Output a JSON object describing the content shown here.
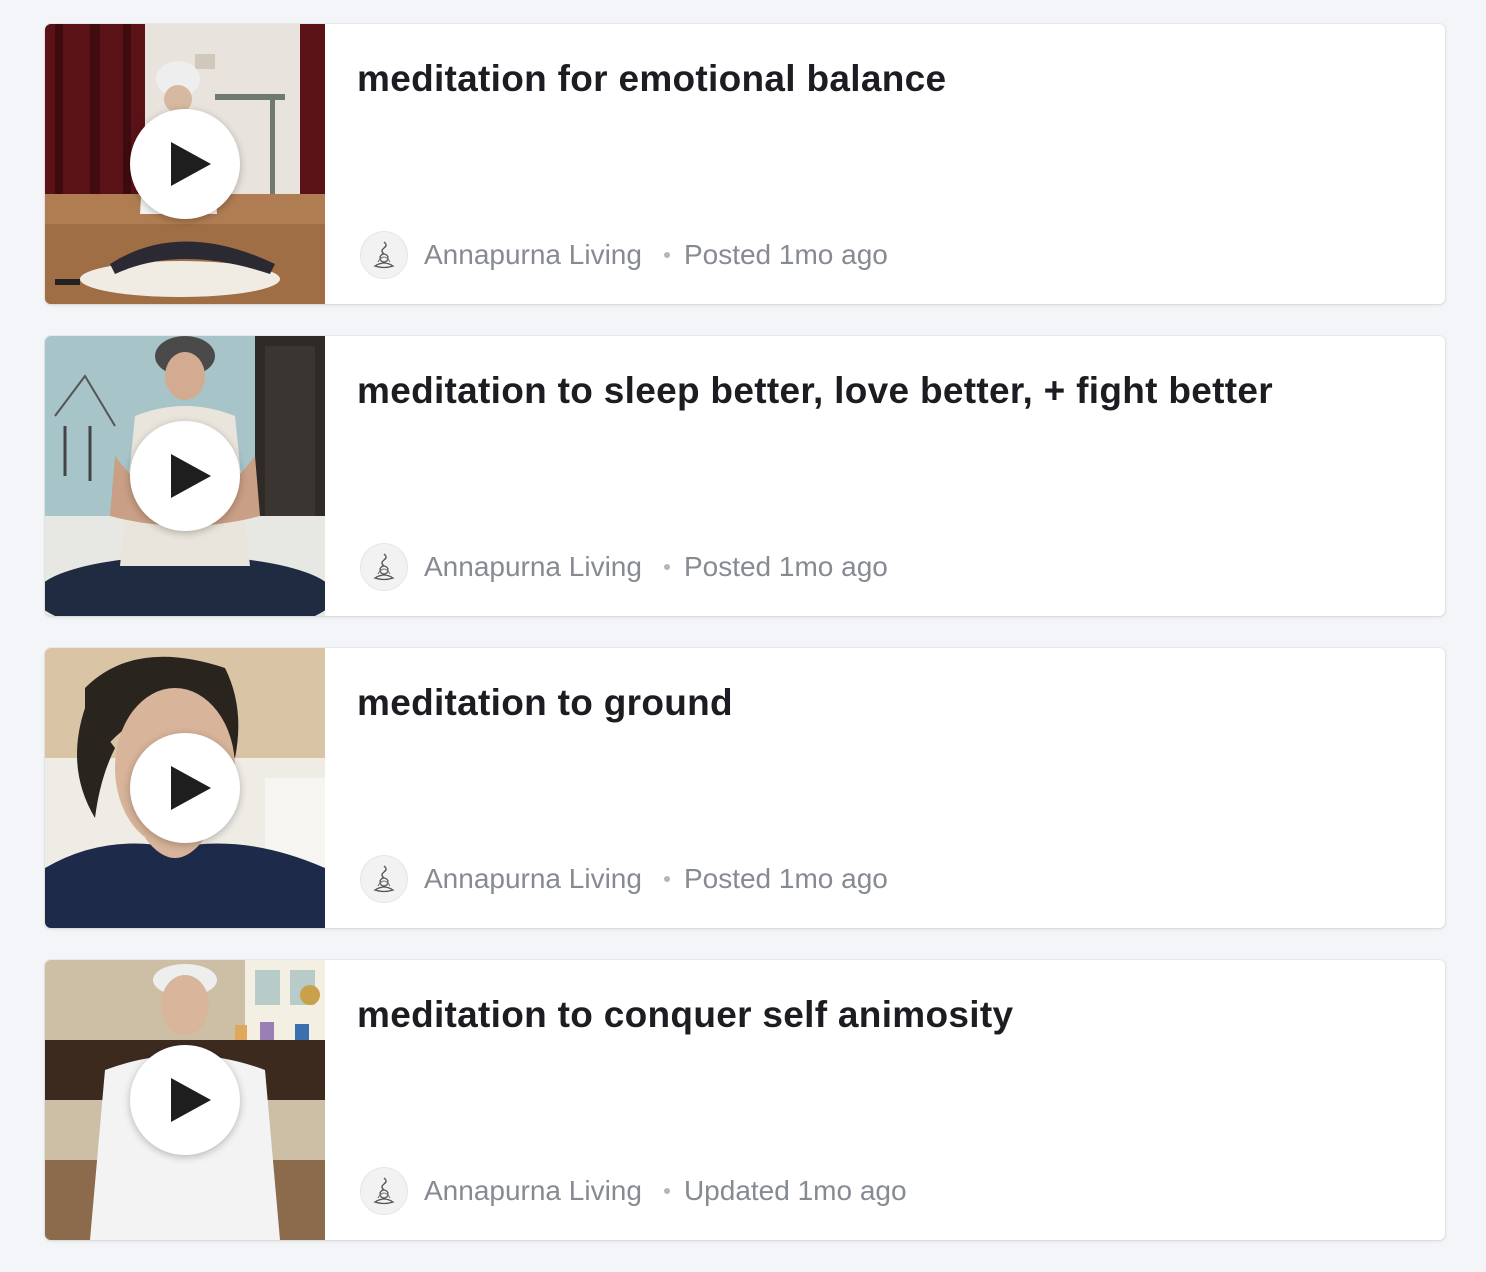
{
  "videos": [
    {
      "title": "meditation for emotional balance",
      "author": "Annapurna Living",
      "status": "Posted 1mo ago",
      "thumbnail": "woman-meditating-room"
    },
    {
      "title": "meditation to sleep better, love better, + fight better",
      "author": "Annapurna Living",
      "status": "Posted 1mo ago",
      "thumbnail": "woman-hands-on-heart"
    },
    {
      "title": "meditation to ground",
      "author": "Annapurna Living",
      "status": "Posted 1mo ago",
      "thumbnail": "woman-closeup-portrait"
    },
    {
      "title": "meditation to conquer self animosity",
      "author": "Annapurna Living",
      "status": "Updated 1mo ago",
      "thumbnail": "woman-headband-altar"
    }
  ],
  "icons": {
    "play": "play-icon",
    "avatar": "annapurna-logo-icon"
  },
  "colors": {
    "background": "#f4f5f8",
    "card": "#ffffff",
    "title": "#1c1c22",
    "meta": "#868a92"
  }
}
